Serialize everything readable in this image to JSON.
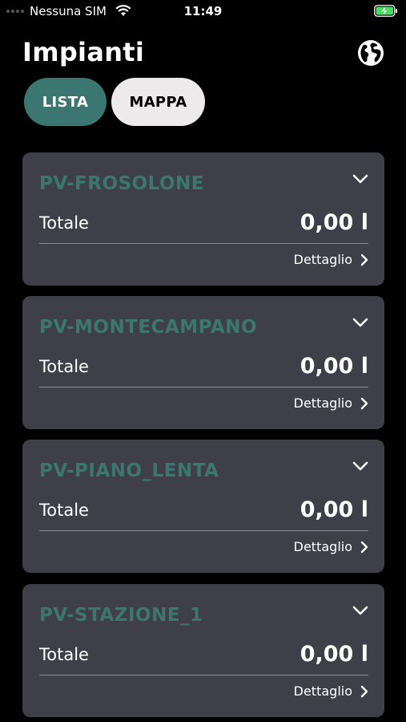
{
  "status_bar": {
    "carrier": "Nessuna SIM",
    "time": "11:49"
  },
  "header": {
    "title": "Impianti",
    "globe_icon": "globe-icon"
  },
  "tabs": [
    {
      "label": "LISTA",
      "active": true
    },
    {
      "label": "MAPPA",
      "active": false
    }
  ],
  "colors": {
    "accent": "#3c7671",
    "card_bg": "#3f3f49",
    "background": "#000000"
  },
  "plants": [
    {
      "name": "PV-FROSOLONE",
      "total_label": "Totale",
      "total_value": "0,00 l",
      "detail_label": "Dettaglio"
    },
    {
      "name": "PV-MONTECAMPANO",
      "total_label": "Totale",
      "total_value": "0,00 l",
      "detail_label": "Dettaglio"
    },
    {
      "name": "PV-PIANO_LENTA",
      "total_label": "Totale",
      "total_value": "0,00 l",
      "detail_label": "Dettaglio"
    },
    {
      "name": "PV-STAZIONE_1",
      "total_label": "Totale",
      "total_value": "0,00 l",
      "detail_label": "Dettaglio"
    }
  ]
}
